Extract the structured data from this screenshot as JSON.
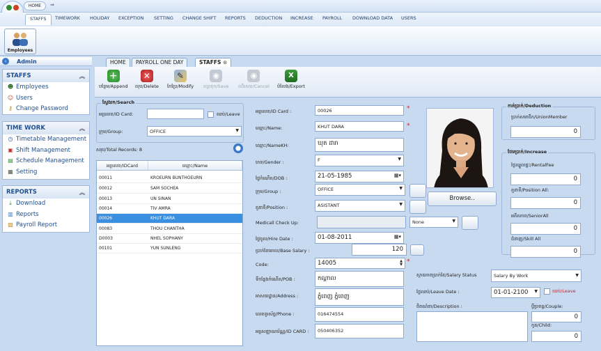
{
  "titlebar": {
    "home_label": "HOME",
    "qat_label": "⇒"
  },
  "menu": {
    "items": [
      "STAFFS",
      "TIMEWORK",
      "HOLIDAY",
      "EXCEPTION",
      "SETTING",
      "CHANGE SHIFT",
      "REPORTS",
      "DEDUCTION",
      "INCREASE",
      "PAYROLL",
      "DOWNLOAD DATA",
      "USERS"
    ],
    "active": "STAFFS"
  },
  "ribbon": {
    "employees_label": "Employees"
  },
  "sidebar": {
    "user": "Admin",
    "groups": [
      {
        "title": "STAFFS",
        "items": [
          {
            "label": "Employees",
            "icon": "users-icon"
          },
          {
            "label": "Users",
            "icon": "user-icon"
          },
          {
            "label": "Change Password",
            "icon": "key-icon"
          }
        ]
      },
      {
        "title": "TIME WORK",
        "items": [
          {
            "label": "Timetable Management",
            "icon": "clock-icon"
          },
          {
            "label": "Shift Management",
            "icon": "shift-icon"
          },
          {
            "label": "Schedule Management",
            "icon": "schedule-icon"
          },
          {
            "label": "Setting",
            "icon": "setting-icon"
          }
        ]
      },
      {
        "title": "REPORTS",
        "items": [
          {
            "label": "Download",
            "icon": "download-icon"
          },
          {
            "label": "Reports",
            "icon": "reports-icon"
          },
          {
            "label": "Payroll Report",
            "icon": "payroll-icon"
          }
        ]
      }
    ]
  },
  "tabs": [
    "HOME",
    "PAYROLL ONE DAY",
    "STAFFS"
  ],
  "toolbar": {
    "append": "បន្ថែម/Append",
    "delete": "លុប/Delete",
    "modify": "កែប្រែ/Modify",
    "save": "រក្សាទុក/Save",
    "cancel": "បដិសេធ/Cancel",
    "export": "បំលែង/Export"
  },
  "search": {
    "legend": "ស្វែងរក/Search",
    "id_label": "អត្តលេខ/ID Card:",
    "id_value": "",
    "leave_label": "ឈប់/Leave",
    "group_label": "ក្រុម/Group:",
    "group_value": "OFFICE",
    "total_records": "សរុប/Total Records: 8"
  },
  "grid": {
    "headers": [
      "អត្តលេខ/IDCard",
      "ឈ្មោះ/Name"
    ],
    "rows": [
      [
        "00011",
        "KROEURN BUNTHOEURN"
      ],
      [
        "00012",
        "SAM SOCHEA"
      ],
      [
        "00013",
        "UN SINAN"
      ],
      [
        "00014",
        "TIV AMRA"
      ],
      [
        "00026",
        "KHUT DARA"
      ],
      [
        "00083",
        "THOU CHANTHA"
      ],
      [
        "D0003",
        "NHEL SOPHANY"
      ],
      [
        "00101",
        "YUN SUNLENG"
      ]
    ],
    "selected_index": 4
  },
  "form": {
    "id_card": {
      "label": "អត្តលេខ/ID Card :",
      "value": "00026"
    },
    "name": {
      "label": "ឈ្មោះ/Name:",
      "value": "KHUT DARA"
    },
    "name_kh": {
      "label": "ឈ្មោះ/NameKH:",
      "value": "ឃុត ដារា"
    },
    "gender": {
      "label": "ភេទ/Gender :",
      "value": "F"
    },
    "dob": {
      "label": "ថ្ងៃកំណើត/DOB :",
      "value": "21-05-1985"
    },
    "group": {
      "label": "ក្រុម/Group :",
      "value": "OFFICE"
    },
    "position": {
      "label": "តួនាទី/Position :",
      "value": "ASISTANT"
    },
    "medical": {
      "label": "Medicall Check Up:",
      "value": "",
      "none_value": "None"
    },
    "hire_date": {
      "label": "ថ្ងៃចូល/Hire Date :",
      "value": "01-08-2011"
    },
    "base_salary": {
      "label": "ប្រាក់ខែគោល/Base Salary :",
      "value": "120"
    },
    "code": {
      "label": "Code:",
      "value": "14005"
    },
    "pob": {
      "label": "ទីកន្លែងកំណើត/POB :",
      "value": "កណ្ដាល"
    },
    "address": {
      "label": "អាសយដ្ឋាន/Address :",
      "value": "ភ្នំពេញ ភ្នំពេញ"
    },
    "phone": {
      "label": "លេខទូរស័ព្ទ/Phone :",
      "value": "016474554"
    },
    "id_card2": {
      "label": "អត្តសញ្ញាណប័ណ្ណ/ID CARD :",
      "value": "050406352"
    },
    "salary_status": {
      "label": "ស្ថានភាពប្រាក់ខែ/Salary Status",
      "value": "Salary By Work"
    },
    "leave_date": {
      "label": "ថ្ងៃឈប់/Leave Date :",
      "value": "01-01-2100",
      "leave_check": "ឈប់/Leave"
    },
    "description": {
      "label": "ពិពណ៌នា/Description :",
      "value": ""
    },
    "browse": "Browse.."
  },
  "deduction": {
    "legend": "កាត់ប្រាក់/Deduction",
    "union_label": "ប្រាក់សមាជិក/UnionMember",
    "union_value": "0"
  },
  "increase": {
    "legend": "ថែមប្រាក់/Increase",
    "rental_label": "ថ្លៃឈ្នួលផ្ទះ/RentalFee",
    "rental_value": "0",
    "position_label": "តួនាទី/Position All:",
    "position_value": "0",
    "senior_label": "អតីតភាព/SeniorAll",
    "senior_value": "0",
    "skill_label": "ជំនាញ/Skill All",
    "skill_value": "0"
  },
  "family": {
    "couple_label": "ប្ដីប្រពន្ធ/Couple:",
    "couple_value": "0",
    "child_label": "កូន/Child:",
    "child_value": "0"
  }
}
